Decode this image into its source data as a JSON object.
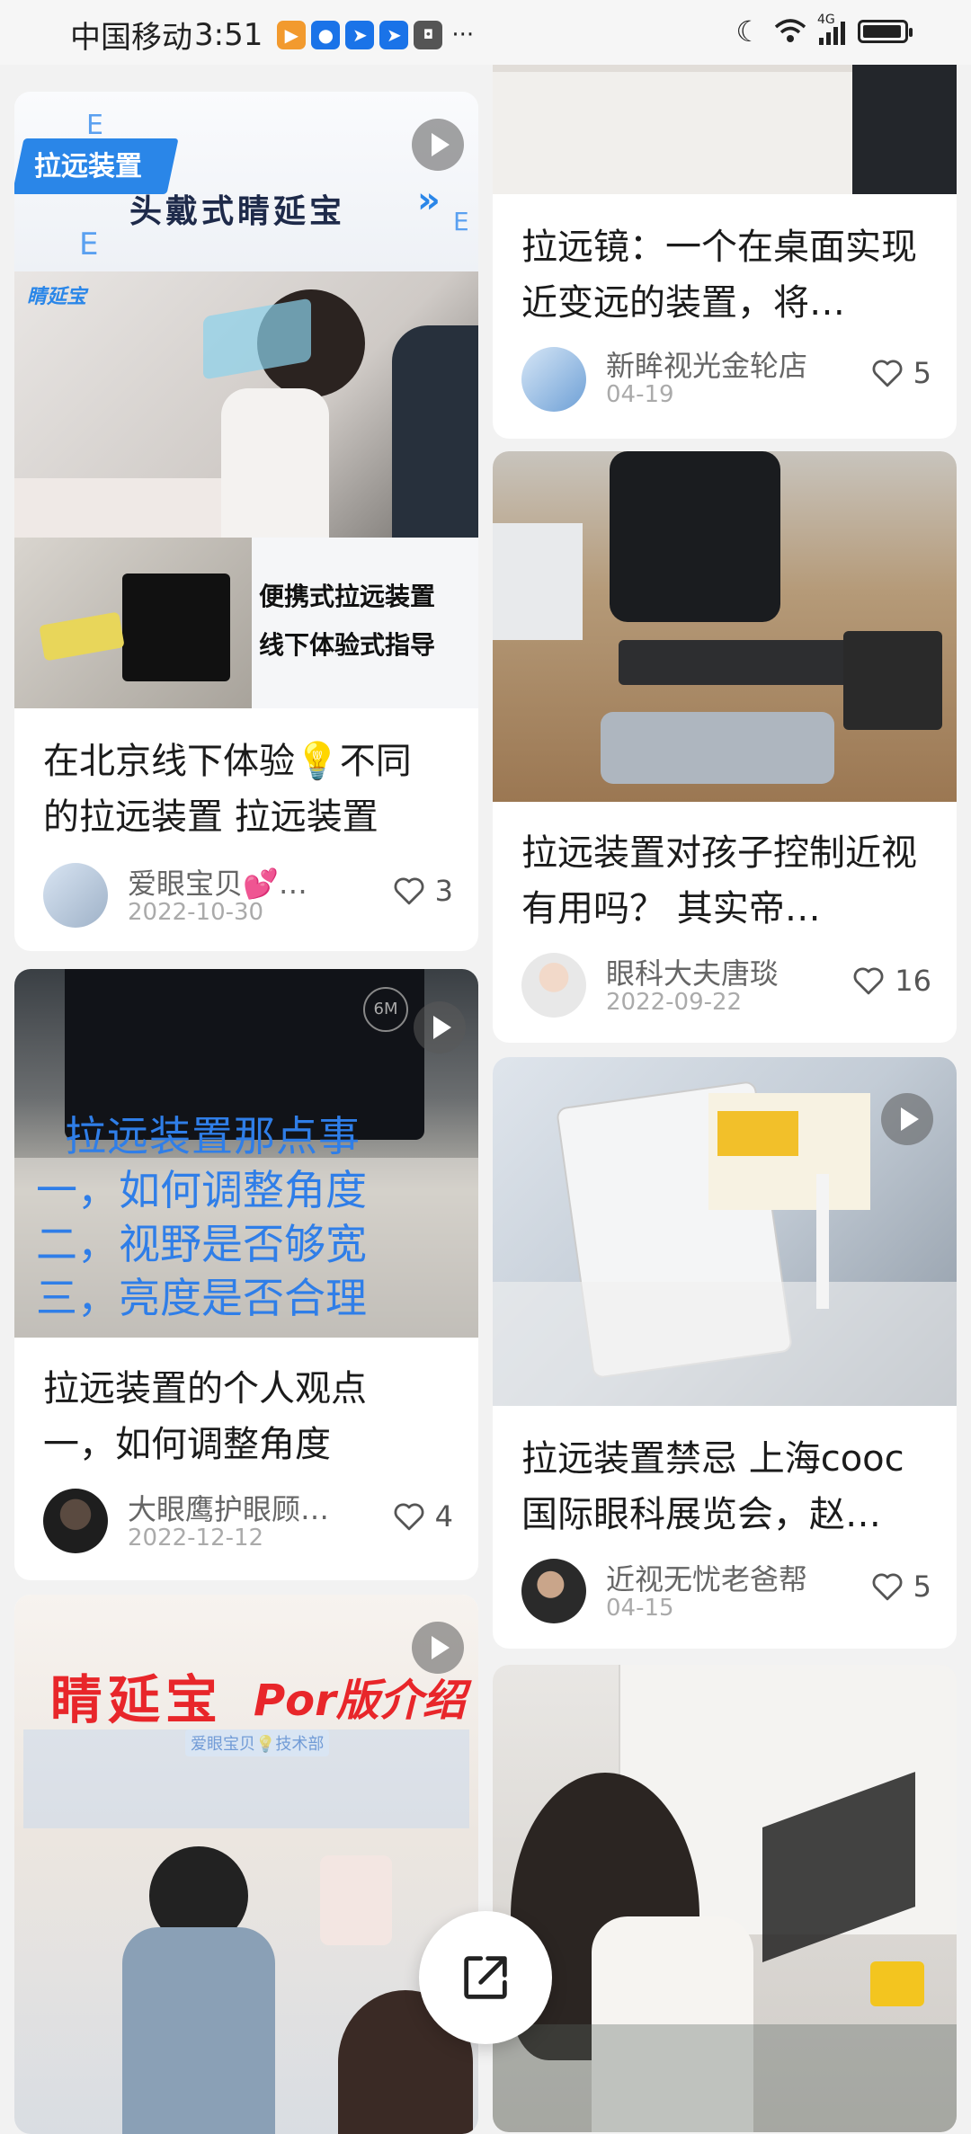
{
  "status_bar": {
    "carrier": "中国移动",
    "time": "3:51",
    "more": "···",
    "network": "4G"
  },
  "feed": {
    "left": [
      {
        "banner_tag": "拉远装置",
        "banner_title": "头戴式睛延宝",
        "brand": "睛延宝",
        "caption_line1": "便携式拉远装置",
        "caption_line2": "线下体验式指导",
        "title": "在北京线下体验💡不同的拉远装置 拉远装置",
        "author": "爱眼宝贝💕…",
        "date": "2022-10-30",
        "likes": "3"
      },
      {
        "overlay_title": "拉远装置那点事",
        "overlay_line1": "一，如何调整角度",
        "overlay_line2": "二，视野是否够宽",
        "overlay_line3": "三，亮度是否合理",
        "title": "拉远装置的个人观点 一，如何调整角度",
        "author": "大眼鹰护眼顾…",
        "date": "2022-12-12",
        "likes": "4"
      },
      {
        "banner_brand": "睛延宝",
        "banner_sub": "Por版介绍",
        "badge": "爱眼宝贝💡技术部"
      }
    ],
    "right": [
      {
        "title": "拉远镜：一个在桌面实现近变远的装置，将…",
        "author": "新眸视光金轮店",
        "date": "04-19",
        "likes": "5"
      },
      {
        "title": "拉远装置对孩子控制近视有用吗？ 其实帝…",
        "author": "眼科大夫唐琰",
        "date": "2022-09-22",
        "likes": "16"
      },
      {
        "title": "拉远装置禁忌 上海cooc国际眼科展览会，赵…",
        "author": "近视无忧老爸帮",
        "date": "04-15",
        "likes": "5"
      },
      {}
    ]
  },
  "colors": {
    "blue_text": "#2f7ee8",
    "red_brand": "#e8262a",
    "heart": "#555555"
  }
}
